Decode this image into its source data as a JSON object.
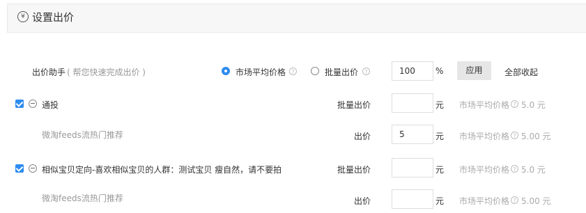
{
  "header": {
    "icon": "yen-icon",
    "title": "设置出价"
  },
  "assistant": {
    "label": "出价助手",
    "hint": "( 帮您快速完成出价 )",
    "option_market": "市场平均价格",
    "option_batch": "批量出价",
    "percent_value": "100",
    "percent_unit": "%",
    "apply_label": "应用",
    "collapse_label": "全部收起"
  },
  "units": {
    "yuan": "元"
  },
  "groups": [
    {
      "name": "通投",
      "checked": true,
      "batch_label": "批量出价",
      "batch_value": "",
      "market_label": "市场平均价格",
      "market_price": "5.0 元",
      "sub": {
        "name": "微淘feeds流热门推荐",
        "bid_label": "出价",
        "bid_value": "5",
        "market_label": "市场平均价格",
        "market_price": "5.00 元"
      }
    },
    {
      "name": "相似宝贝定向-喜欢相似宝贝的人群：测试宝贝 瘦自然，请不要拍",
      "checked": true,
      "batch_label": "批量出价",
      "batch_value": "",
      "market_label": "市场平均价格",
      "market_price": "5.0 元",
      "sub": {
        "name": "微淘feeds流热门推荐",
        "bid_label": "出价",
        "bid_value": "",
        "market_label": "市场平均价格",
        "market_price": "5.00 元"
      }
    }
  ]
}
